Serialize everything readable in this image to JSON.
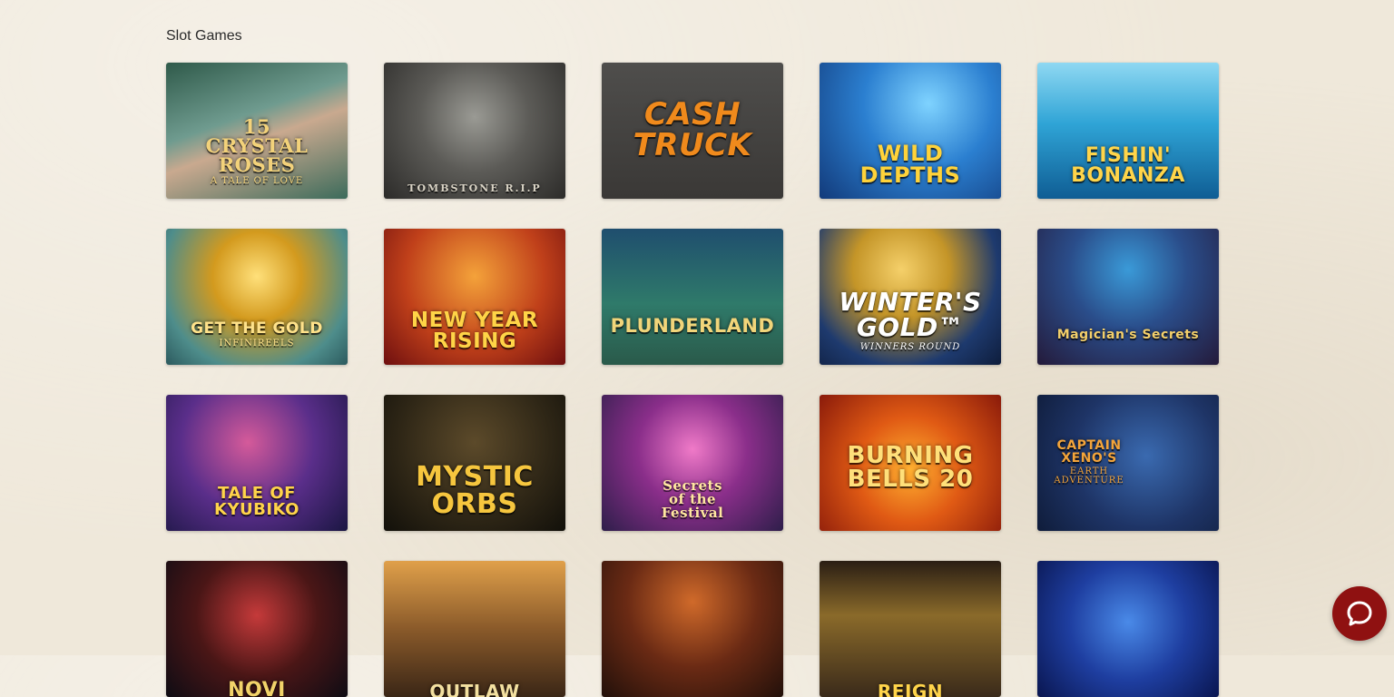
{
  "section": {
    "title": "Slot Games"
  },
  "games": [
    {
      "title": "15\nCRYSTAL ROSES",
      "subtitle": "A TALE OF LOVE"
    },
    {
      "title": "TOMBSTONE R.I.P",
      "subtitle": ""
    },
    {
      "title": "CASH\nTRUCK",
      "subtitle": ""
    },
    {
      "title": "WILD DEPTHS",
      "subtitle": ""
    },
    {
      "title": "FISHIN'\nBONANZA",
      "subtitle": ""
    },
    {
      "title": "GET THE GOLD",
      "subtitle": "INFINIREELS"
    },
    {
      "title": "NEW YEAR\nRISING",
      "subtitle": ""
    },
    {
      "title": "PLUNDERLAND",
      "subtitle": ""
    },
    {
      "title": "WINTER'S\nGOLD™",
      "subtitle": "WINNERS ROUND"
    },
    {
      "title": "Magician's Secrets",
      "subtitle": ""
    },
    {
      "title": "TALE OF\nKYUBIKO",
      "subtitle": ""
    },
    {
      "title": "MYSTIC\nORBS",
      "subtitle": ""
    },
    {
      "title": "Secrets\nof the\nFestival",
      "subtitle": ""
    },
    {
      "title": "BURNING\nBELLS 20",
      "subtitle": ""
    },
    {
      "title": "CAPTAIN\nXENO'S",
      "subtitle": "EARTH ADVENTURE"
    },
    {
      "title": "NOVI",
      "subtitle": ""
    },
    {
      "title": "OUTLAW",
      "subtitle": ""
    },
    {
      "title": "",
      "subtitle": ""
    },
    {
      "title": "REIGN",
      "subtitle": ""
    },
    {
      "title": "",
      "subtitle": ""
    }
  ],
  "chat": {
    "icon": "chat-bubble-icon"
  }
}
